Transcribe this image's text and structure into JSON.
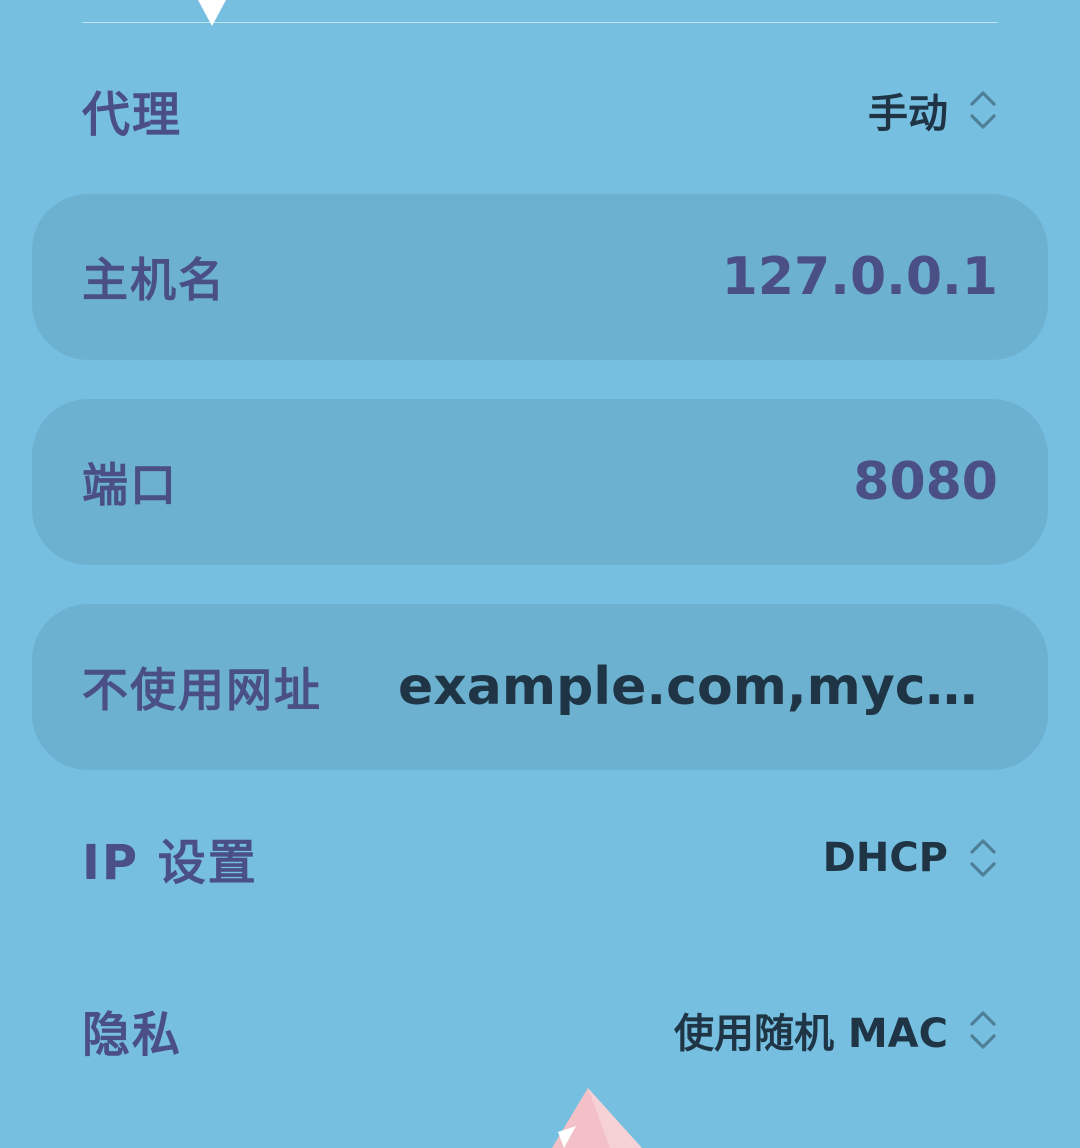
{
  "proxy": {
    "label": "代理",
    "value": "手动",
    "control_icon": "up-down-chevron-icon"
  },
  "hostname": {
    "label": "主机名",
    "value": "127.0.0.1"
  },
  "port": {
    "label": "端口",
    "value": "8080"
  },
  "bypass": {
    "label": "不使用网址",
    "value": "example.com,myco..."
  },
  "ip_settings": {
    "label": "IP 设置",
    "value": "DHCP",
    "control_icon": "up-down-chevron-icon"
  },
  "privacy": {
    "label": "隐私",
    "value": "使用随机 MAC",
    "control_icon": "up-down-chevron-icon"
  },
  "colors": {
    "background": "#76bfe0",
    "card": "#6cb1cf",
    "label": "#4a4f86",
    "value": "#1f3545"
  }
}
